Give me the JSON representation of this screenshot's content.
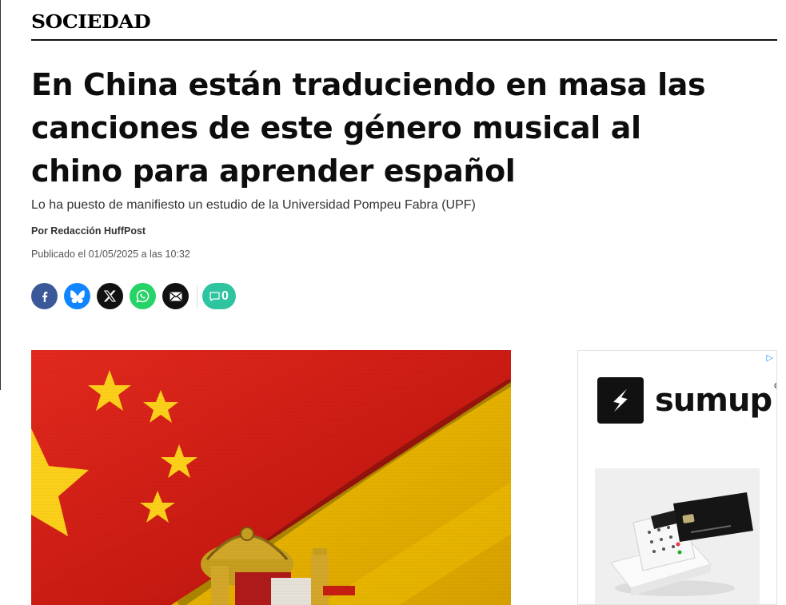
{
  "section": "SOCIEDAD",
  "headline": "En China están traduciendo en masa las canciones de este género musical al chino para aprender español",
  "subtitle": "Lo ha puesto de manifiesto un estudio de la Universidad Pompeu Fabra (UPF)",
  "byline": "Por Redacción HuffPost",
  "published": "Publicado el 01/05/2025 a las 10:32",
  "share": {
    "facebook_icon": "facebook-icon",
    "bluesky_icon": "bluesky-icon",
    "x_icon": "x-icon",
    "whatsapp_icon": "whatsapp-icon",
    "email_icon": "email-icon",
    "comments_count": "0"
  },
  "ad": {
    "brand": "sumup",
    "registered": "®",
    "colors": {
      "brand_mark": "#111111"
    }
  },
  "colors": {
    "facebook": "#3b5998",
    "bluesky": "#1185fe",
    "whatsapp": "#25d366",
    "comments": "#2ec4a0",
    "china_red": "#de2910",
    "spain_yellow": "#f1bf00"
  }
}
